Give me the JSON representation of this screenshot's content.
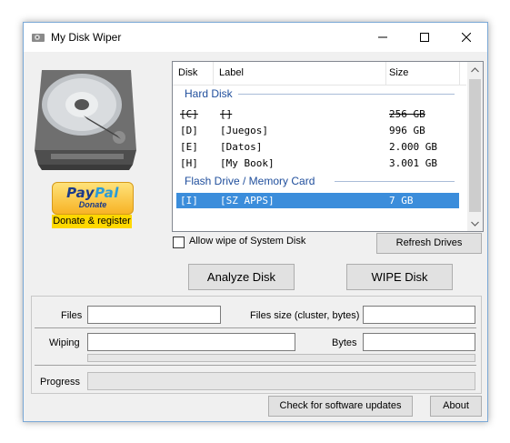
{
  "window": {
    "title": "My Disk Wiper"
  },
  "donate": {
    "paypal_word1": "Pay",
    "paypal_word2": "Pal",
    "paypal_sub": "Donate",
    "register_label": "Donate & register"
  },
  "disk_list": {
    "headers": {
      "disk": "Disk",
      "label": "Label",
      "size": "Size"
    },
    "groups": [
      {
        "title": "Hard Disk",
        "rows": [
          {
            "disk": "[C]",
            "label": "[]",
            "size": "256 GB",
            "struck": true
          },
          {
            "disk": "[D]",
            "label": "[Juegos]",
            "size": "996 GB"
          },
          {
            "disk": "[E]",
            "label": "[Datos]",
            "size": "2.000 GB"
          },
          {
            "disk": "[H]",
            "label": "[My Book]",
            "size": "3.001 GB"
          }
        ]
      },
      {
        "title": "Flash Drive / Memory Card",
        "rows": [
          {
            "disk": "[I]",
            "label": "[SZ APPS]",
            "size": "7 GB",
            "selected": true
          }
        ]
      }
    ]
  },
  "options": {
    "allow_system_wipe_label": "Allow wipe of System Disk",
    "allow_system_wipe_checked": false
  },
  "buttons": {
    "refresh": "Refresh Drives",
    "analyze": "Analyze Disk",
    "wipe": "WIPE Disk",
    "updates": "Check for software updates",
    "about": "About"
  },
  "fields": {
    "files_label": "Files",
    "files_value": "",
    "files_size_label": "Files size (cluster, bytes)",
    "files_size_value": "",
    "wiping_label": "Wiping",
    "wiping_value": "",
    "bytes_label": "Bytes",
    "bytes_value": "",
    "progress_label": "Progress"
  },
  "progress": {
    "wiping_bar": 0,
    "overall": 0
  },
  "icons": [
    "app-disk-icon",
    "minimize-icon",
    "maximize-icon",
    "close-icon",
    "hard-disk-image",
    "scroll-up-icon",
    "scroll-down-icon"
  ]
}
